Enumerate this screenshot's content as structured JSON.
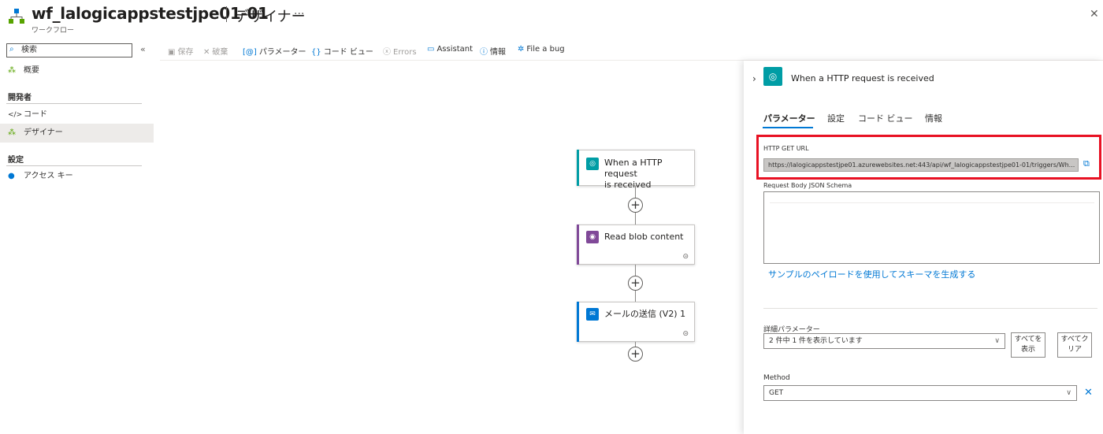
{
  "header": {
    "title": "wf_lalogicappstestjpe01-01",
    "subtitle": "デザイナー",
    "more": "...",
    "caption": "ワークフロー",
    "close": "✕"
  },
  "sidebar": {
    "search_placeholder": "検索",
    "collapse": "«",
    "overview": "概要",
    "section_dev": "開発者",
    "code": "コード",
    "designer": "デザイナー",
    "section_settings": "設定",
    "access_keys": "アクセス キー"
  },
  "toolbar": {
    "save": "保存",
    "discard": "破棄",
    "parameters": "パラメーター",
    "code_view": "コード ビュー",
    "errors": "Errors",
    "assistant": "Assistant",
    "info": "情報",
    "file_bug": "File a bug"
  },
  "canvas": {
    "nodes": [
      {
        "title_line1": "When a HTTP request",
        "title_line2": "is received",
        "color": "#009da5"
      },
      {
        "title": "Read blob content",
        "color": "#804998"
      },
      {
        "title": "メールの送信 (V2) 1",
        "color": "#0078d4"
      }
    ]
  },
  "panel": {
    "title": "When a HTTP request is received",
    "tabs": [
      "パラメーター",
      "設定",
      "コード ビュー",
      "情報"
    ],
    "http_get_url_label": "HTTP GET URL",
    "http_get_url": "https://lalogicappstestjpe01.azurewebsites.net:443/api/wf_lalogicappstestjpe01-01/triggers/Wh...",
    "schema_label": "Request Body JSON Schema",
    "sample_link": "サンプルのペイロードを使用してスキーマを生成する",
    "advanced_label": "詳細パラメーター",
    "advanced_value": "2 件中 1 件を表示しています",
    "show_all_1": "すべてを",
    "show_all_2": "表示",
    "clear_all_1": "すべてク",
    "clear_all_2": "リア",
    "method_label": "Method",
    "method_value": "GET"
  },
  "colors": {
    "accent": "#0078d4",
    "highlight": "#e81123",
    "trigger": "#009da5"
  }
}
